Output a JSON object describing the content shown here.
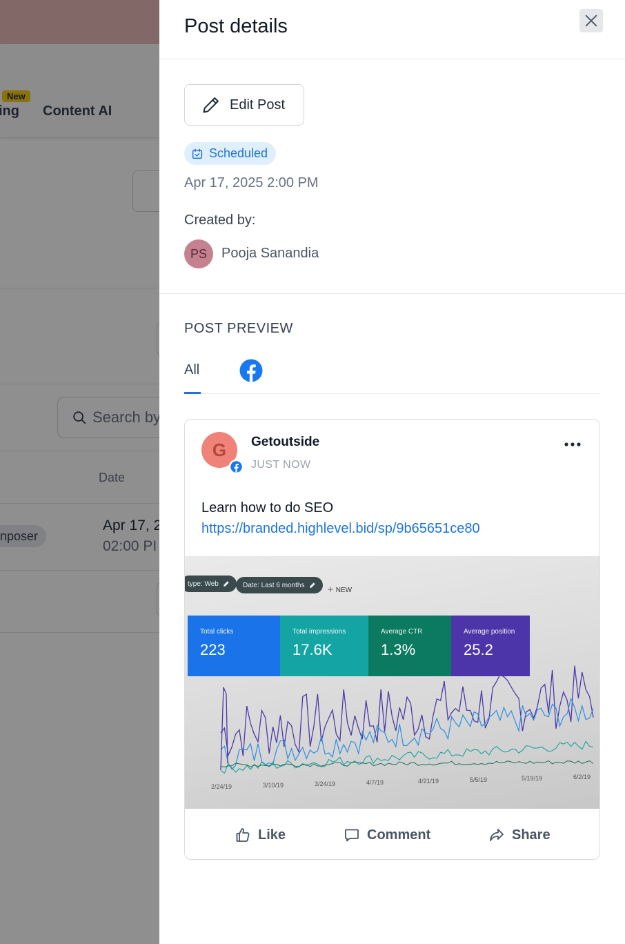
{
  "background": {
    "nav_items": [
      "ing",
      "Content AI"
    ],
    "new_badge": "New",
    "search_placeholder": "Search by",
    "table_header_date": "Date",
    "row_tag": "nposer",
    "row_date": "Apr 17, 2",
    "row_time": "02:00 PI"
  },
  "drawer": {
    "title": "Post details",
    "edit_button_label": "Edit Post",
    "status": "Scheduled",
    "scheduled_datetime": "Apr 17, 2025 2:00 PM",
    "created_by_label": "Created by:",
    "creator": {
      "initials": "PS",
      "name": "Pooja Sanandia"
    },
    "preview": {
      "heading": "POST PREVIEW",
      "tabs": [
        {
          "label": "All",
          "active": true
        },
        {
          "icon": "facebook-icon"
        }
      ]
    },
    "post": {
      "page_initial": "G",
      "page_name": "Getoutside",
      "time": "JUST NOW",
      "text": "Learn how to do SEO",
      "link": "https://branded.highlevel.bid/sp/9b65651ce80",
      "image": {
        "filters": [
          "type: Web",
          "Date: Last 6 months"
        ],
        "new_label": "NEW",
        "metrics": [
          {
            "label": "Total clicks",
            "value": "223",
            "color": "#1a73e8"
          },
          {
            "label": "Total impressions",
            "value": "17.6K",
            "color": "#14a4a4"
          },
          {
            "label": "Average CTR",
            "value": "1.3%",
            "color": "#0b7a60"
          },
          {
            "label": "Average position",
            "value": "25.2",
            "color": "#4c35a8"
          }
        ],
        "x_ticks": [
          "2/24/19",
          "3/10/19",
          "3/24/19",
          "4/7/19",
          "4/21/19",
          "5/5/19",
          "5/19/19",
          "6/2/19"
        ]
      },
      "actions": {
        "like": "Like",
        "comment": "Comment",
        "share": "Share"
      }
    }
  },
  "colors": {
    "accent": "#1d74d9",
    "status_bg": "#e0effe",
    "facebook": "#1877f2"
  }
}
